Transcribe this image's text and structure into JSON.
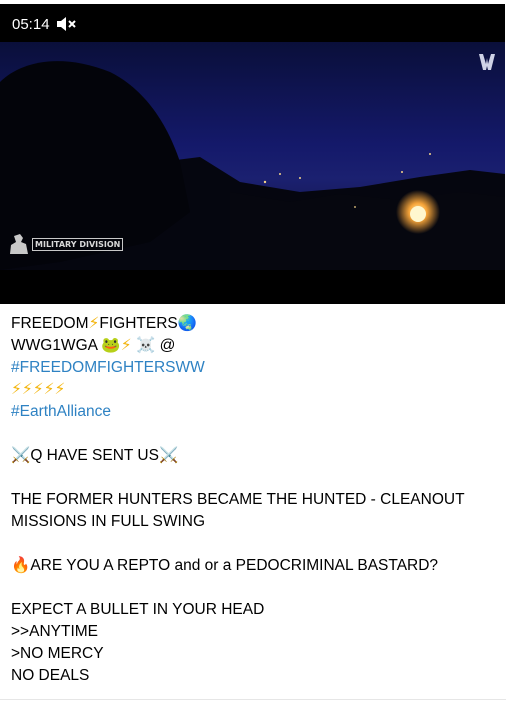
{
  "video": {
    "duration": "05:14",
    "mute_icon": "muted-speaker-icon",
    "watermark_text": "MILITARY DIVISION",
    "corner_logo_icon": "channel-logo-icon"
  },
  "caption": {
    "line1_text_a": "FREEDOM",
    "line1_emoji_a": "⚡",
    "line1_text_b": "FIGHTERS",
    "line1_emoji_b": "🌏",
    "line2_text": "WWG1WGA",
    "line2_emoji_frog": "🐸",
    "line2_emoji_bolt": "⚡",
    "line2_emoji_skull": "☠️",
    "line2_at": "@",
    "hashtag1": "#FREEDOMFIGHTERSWW",
    "bolts": "⚡⚡⚡⚡⚡",
    "hashtag2": "#EarthAlliance",
    "swords_emoji": "⚔️",
    "q_line": "Q HAVE SENT US",
    "hunted_line": "THE FORMER HUNTERS BECAME THE HUNTED - CLEANOUT MISSIONS IN FULL SWING",
    "fire_emoji": "🔥",
    "repto_line": "ARE YOU A REPTO and or a PEDOCRIMINAL BASTARD?",
    "bullet_line": "EXPECT A BULLET IN YOUR HEAD",
    "anytime_line": ">>ANYTIME",
    "mercy_line": ">NO MERCY",
    "deals_line": "NO DEALS"
  },
  "colors": {
    "hashtag": "#2e82c3",
    "text": "#000000",
    "background": "#ffffff",
    "video_bg": "#000000"
  }
}
